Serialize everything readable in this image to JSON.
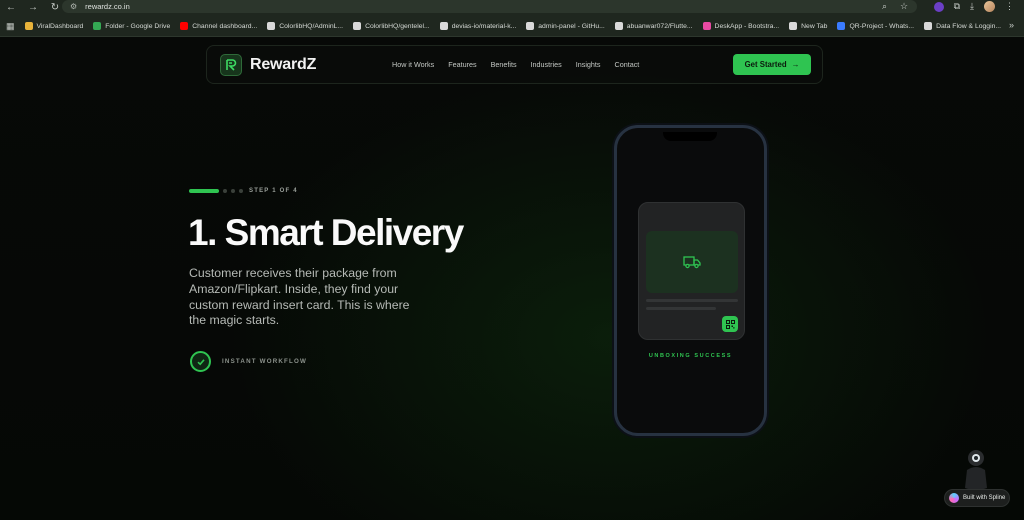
{
  "browser": {
    "url": "rewardz.co.in",
    "bookmarks": [
      {
        "label": "ViralDashboard",
        "color": "#e8b33a"
      },
      {
        "label": "Folder - Google Drive",
        "color": "#34a853"
      },
      {
        "label": "Channel dashboard...",
        "color": "#ff0000"
      },
      {
        "label": "ColorlibHQ/AdminL...",
        "color": "#d9d9d9"
      },
      {
        "label": "ColorlibHQ/gentelel...",
        "color": "#d9d9d9"
      },
      {
        "label": "devias-io/material-k...",
        "color": "#d9d9d9"
      },
      {
        "label": "admin-panel - GitHu...",
        "color": "#d9d9d9"
      },
      {
        "label": "abuanwar072/Flutte...",
        "color": "#d9d9d9"
      },
      {
        "label": "DeskApp - Bootstra...",
        "color": "#e94aa3"
      },
      {
        "label": "New Tab",
        "color": "#d9d9d9"
      },
      {
        "label": "QR-Project - Whats...",
        "color": "#3a7bff"
      },
      {
        "label": "Data Flow & Loggin...",
        "color": "#d9d9d9"
      }
    ]
  },
  "nav": {
    "brand": "RewardZ",
    "links": [
      "How it Works",
      "Features",
      "Benefits",
      "Industries",
      "Insights",
      "Contact"
    ],
    "cta_label": "Get Started",
    "cta_arrow": "→"
  },
  "hero": {
    "step_label": "STEP 1 OF 4",
    "step_progress": 0.25,
    "title": "1. Smart Delivery",
    "description": "Customer receives their package from Amazon/Flipkart. Inside, they find your custom reward insert card. This is where the magic starts.",
    "badge_label": "INSTANT WORKFLOW"
  },
  "phone": {
    "caption": "UNBOXING SUCCESS"
  },
  "spline": {
    "label": "Built with Spline"
  },
  "colors": {
    "accent": "#2fc451",
    "background": "#050705"
  }
}
